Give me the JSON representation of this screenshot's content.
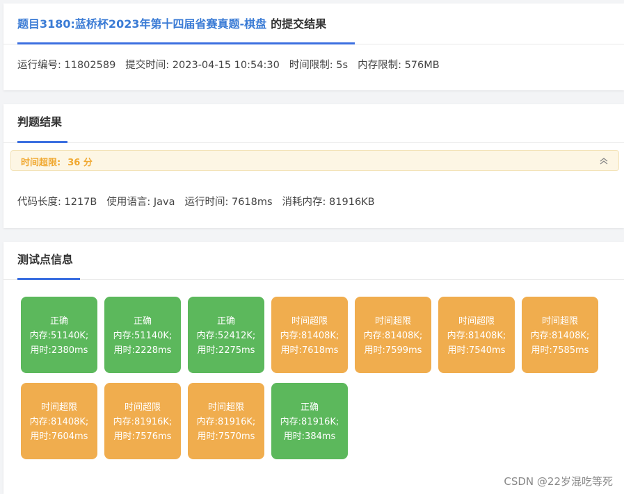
{
  "submission": {
    "title_link": "题目3180:蓝桥杯2023年第十四届省赛真题-棋盘",
    "title_suffix": "的提交结果",
    "run_id_label": "运行编号: 11802589",
    "submit_time_label": "提交时间: 2023-04-15 10:54:30",
    "time_limit_label": "时间限制: 5s",
    "memory_limit_label": "内存限制: 576MB"
  },
  "judge": {
    "title": "判题结果",
    "status_label": "时间超限:",
    "score_label": "36 分",
    "status_color": "#f0a830",
    "code_length_label": "代码长度: 1217B",
    "language_label": "使用语言: Java",
    "run_time_label": "运行时间: 7618ms",
    "memory_used_label": "消耗内存: 81916KB"
  },
  "tests": {
    "title": "测试点信息",
    "colors": {
      "ok": "#5cb85c",
      "tle": "#f0ad4e"
    },
    "items": [
      {
        "status": "正确",
        "memory": "内存:51140K;",
        "time": "用时:2380ms",
        "kind": "ok"
      },
      {
        "status": "正确",
        "memory": "内存:51140K;",
        "time": "用时:2228ms",
        "kind": "ok"
      },
      {
        "status": "正确",
        "memory": "内存:52412K;",
        "time": "用时:2275ms",
        "kind": "ok"
      },
      {
        "status": "时间超限",
        "memory": "内存:81408K;",
        "time": "用时:7618ms",
        "kind": "tle"
      },
      {
        "status": "时间超限",
        "memory": "内存:81408K;",
        "time": "用时:7599ms",
        "kind": "tle"
      },
      {
        "status": "时间超限",
        "memory": "内存:81408K;",
        "time": "用时:7540ms",
        "kind": "tle"
      },
      {
        "status": "时间超限",
        "memory": "内存:81408K;",
        "time": "用时:7585ms",
        "kind": "tle"
      },
      {
        "status": "时间超限",
        "memory": "内存:81408K;",
        "time": "用时:7604ms",
        "kind": "tle"
      },
      {
        "status": "时间超限",
        "memory": "内存:81916K;",
        "time": "用时:7576ms",
        "kind": "tle"
      },
      {
        "status": "时间超限",
        "memory": "内存:81916K;",
        "time": "用时:7570ms",
        "kind": "tle"
      },
      {
        "status": "正确",
        "memory": "内存:81916K;",
        "time": "用时:384ms",
        "kind": "ok"
      }
    ]
  },
  "watermark": "CSDN @22岁混吃等死",
  "icons": {
    "collapse": "chevron-double-up-icon"
  }
}
